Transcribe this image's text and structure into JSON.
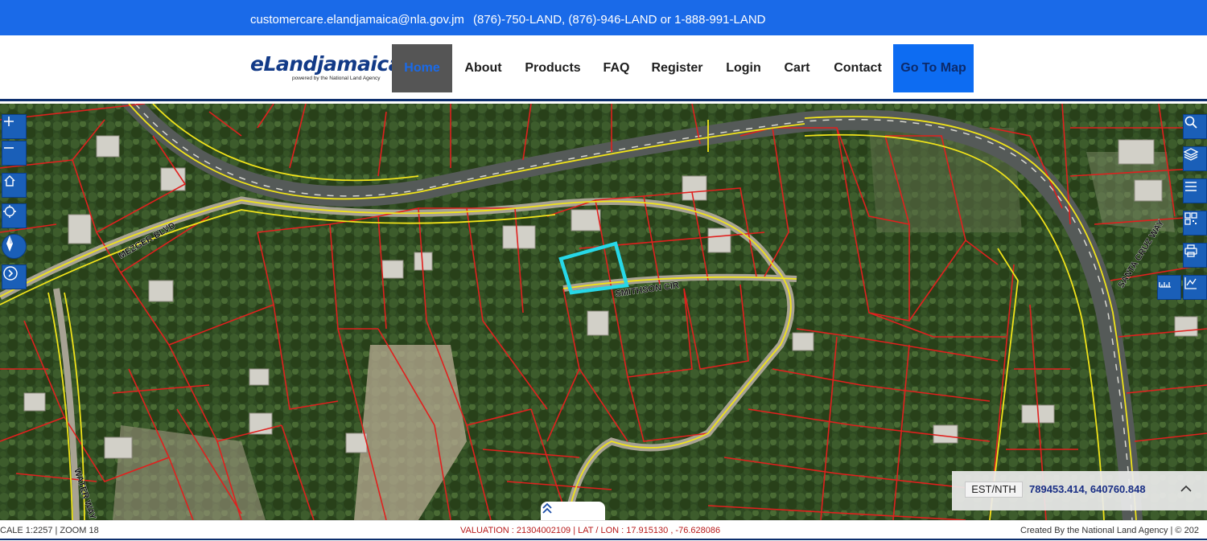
{
  "topbar": {
    "email": "customercare.elandjamaica@nla.gov.jm",
    "phones": "(876)-750-LAND, (876)-946-LAND or 1-888-991-LAND"
  },
  "logo": {
    "brand": "eLandjamaica",
    "tagline": "powered by the National Land Agency"
  },
  "nav": {
    "items": [
      {
        "label": "Home"
      },
      {
        "label": "About"
      },
      {
        "label": "Products"
      },
      {
        "label": "FAQ"
      },
      {
        "label": "Register"
      },
      {
        "label": "Login"
      },
      {
        "label": "Cart"
      },
      {
        "label": "Contact"
      },
      {
        "label": "Go To Map"
      }
    ]
  },
  "map": {
    "street_labels": {
      "mezger": "MEZGER BLVD",
      "smithson": "SMITHSON CIR",
      "santa_cruz": "SANTA CRUZ WAY",
      "water": "WATER WAY"
    },
    "left_controls": [
      "zoom-in-icon",
      "zoom-out-icon",
      "home-icon",
      "locate-icon",
      "compass-icon",
      "next-icon"
    ],
    "right_controls": [
      "search-icon",
      "layers-icon",
      "menu-icon",
      "qr-code-icon",
      "print-icon",
      "measure-icon",
      "chart-icon"
    ],
    "coords": {
      "label": "EST/NTH",
      "value": "789453.414, 640760.848"
    }
  },
  "status": {
    "scale_zoom": "CALE 1:2257  |   ZOOM 18",
    "valuation": "VALUATION : 21304002109 | LAT / LON : 17.915130 , -76.628086",
    "credit": "Created By the National Land Agency  |  © 202"
  },
  "colors": {
    "topbar": "#1a6ae8",
    "parcel_lines": "#e0201e",
    "roads": "#f0e31a",
    "selected_parcel": "#27d8e8",
    "controls": "#1a5fb8"
  }
}
